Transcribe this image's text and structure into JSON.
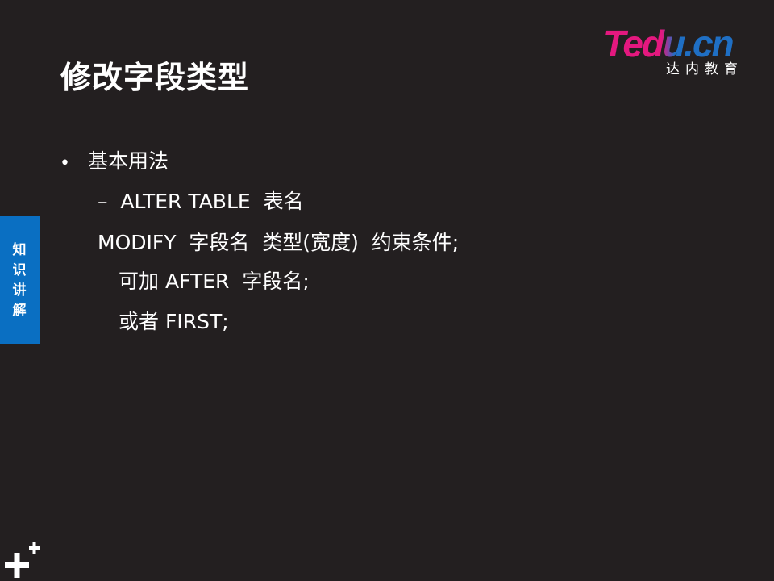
{
  "slide": {
    "title": "修改字段类型",
    "side_tab": "知识讲解"
  },
  "logo": {
    "brand": "Tedu.cn",
    "subtitle": "达内教育",
    "colors": {
      "pink": "#e4187f",
      "blue": "#1f6fc4"
    }
  },
  "colors": {
    "background": "#231f20",
    "text": "#ffffff",
    "tab": "#0a6fc2"
  },
  "bullets": {
    "level1": {
      "marker": "•",
      "text": "基本用法"
    },
    "level2": {
      "marker": "–",
      "text": "ALTER TABLE  表名"
    },
    "syntax_lines": [
      "MODIFY  字段名  类型(宽度)  约束条件;",
      "可加 AFTER  字段名;",
      "或者 FIRST;"
    ]
  },
  "icons": {
    "corner": "plus-cluster-icon"
  }
}
